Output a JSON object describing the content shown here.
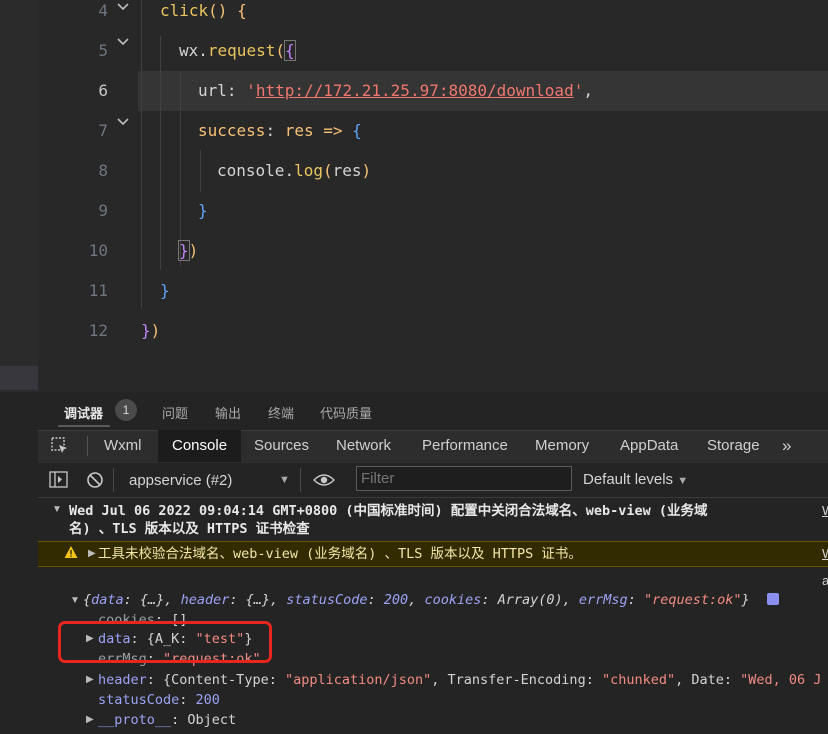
{
  "editor": {
    "line_numbers": [
      "4",
      "5",
      "6",
      "7",
      "8",
      "9",
      "10",
      "11",
      "12"
    ],
    "lines": {
      "l4": {
        "fn": "click",
        "rest": "() {"
      },
      "l5": {
        "obj": "wx",
        "dot": ".",
        "fn": "request",
        "paren": "(",
        "brace": "{"
      },
      "l6": {
        "key": "url",
        "colon": ": ",
        "q1": "'",
        "url": "http://172.21.25.97:8080/download",
        "q2": "'",
        "comma": ","
      },
      "l7": {
        "key": "success",
        "colon": ": ",
        "param": "res",
        "arrow": " => ",
        "brace": "{"
      },
      "l8": {
        "obj": "console",
        "dot": ".",
        "fn": "log",
        "open": "(",
        "arg": "res",
        "close": ")"
      },
      "l9": {
        "brace": "}"
      },
      "l10": {
        "brace": "}",
        "paren": ")"
      },
      "l11": {
        "brace": "}"
      },
      "l12": {
        "brace": "}",
        "paren": ")"
      }
    }
  },
  "devtools": {
    "tabs": [
      "调试器",
      "问题",
      "输出",
      "终端",
      "代码质量"
    ],
    "debugger_badge": "1",
    "panel_tabs": [
      "Wxml",
      "Console",
      "Sources",
      "Network",
      "Performance",
      "Memory",
      "AppData",
      "Storage"
    ],
    "more_tabs": "»",
    "toolbar": {
      "context": "appservice (#2)",
      "filter_placeholder": "Filter",
      "levels": "Default levels"
    }
  },
  "console": {
    "group_header_1": "Wed Jul 06 2022 09:04:14 GMT+0800 (中国标准时间) 配置中关闭合法域名、web-view (业务域",
    "group_header_2": "名) 、TLS 版本以及 HTTPS 证书检查",
    "warning": "工具未校验合法域名、web-view (业务域名) 、TLS 版本以及 HTTPS 证书。",
    "side_link_1": "W",
    "side_link_2": "W",
    "side_link_3": "a",
    "object_summary": {
      "open": "{",
      "k1": "data",
      "v1": ": {…}, ",
      "k2": "header",
      "v2": ": {…}, ",
      "k3": "statusCode",
      "v3c": ": ",
      "v3": "200",
      "sep3": ", ",
      "k4": "cookies",
      "v4": ": Array(0), ",
      "k5": "errMsg",
      "v5c": ": ",
      "v5": "\"request:ok\"",
      "close": "}"
    },
    "rows": {
      "cookies": {
        "key": "cookies",
        "val": ": []"
      },
      "data": {
        "key": "data",
        "pre": ": {A_K: ",
        "str": "\"test\"",
        "post": "}"
      },
      "errMsg": {
        "key": "errMsg",
        "pre": ": ",
        "str": "\"request:ok\""
      },
      "header": {
        "key": "header",
        "pre": ": {Content-Type: ",
        "s1": "\"application/json\"",
        "mid": ", Transfer-Encoding: ",
        "s2": "\"chunked\"",
        "mid2": ", Date: ",
        "s3": "\"Wed, 06 J"
      },
      "statusCode": {
        "key": "statusCode",
        "pre": ": ",
        "num": "200"
      },
      "proto": {
        "key": "__proto__",
        "pre": ": Object"
      }
    }
  },
  "colors": {
    "highlight_box": "#e8261e",
    "warning_bg": "#332b00",
    "url": "#f0776e"
  }
}
